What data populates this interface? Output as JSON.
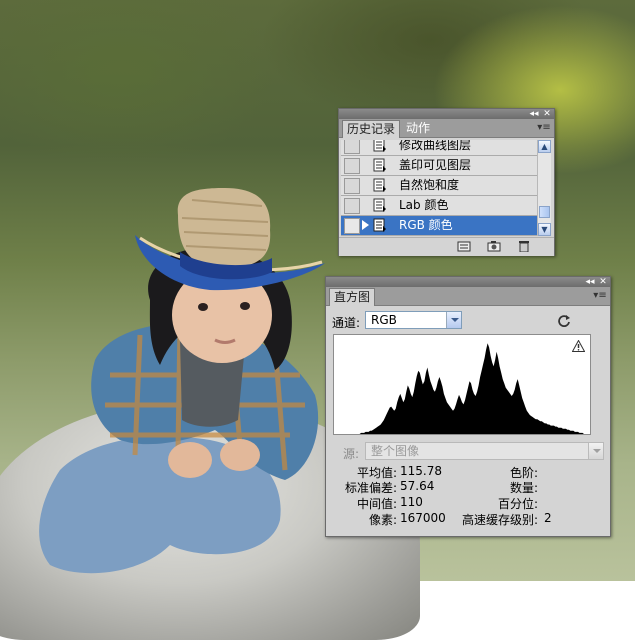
{
  "history_panel": {
    "tabs": [
      {
        "label": "历史记录",
        "active": true
      },
      {
        "label": "动作",
        "active": false
      }
    ],
    "items": [
      {
        "label": "修改曲线图层",
        "selected": false
      },
      {
        "label": "盖印可见图层",
        "selected": false
      },
      {
        "label": "自然饱和度",
        "selected": false
      },
      {
        "label": "Lab 颜色",
        "selected": false
      },
      {
        "label": "RGB 颜色",
        "selected": true
      }
    ],
    "footer_buttons": [
      "new-document-from-state-icon",
      "new-snapshot-icon",
      "delete-state-icon"
    ]
  },
  "histogram_panel": {
    "tab_label": "直方图",
    "channel_label": "通道:",
    "channel_value": "RGB",
    "source_label": "源:",
    "source_value": "整个图像",
    "stats_left": [
      {
        "label": "平均值:",
        "value": "115.78"
      },
      {
        "label": "标准偏差:",
        "value": "57.64"
      },
      {
        "label": "中间值:",
        "value": "110"
      },
      {
        "label": "像素:",
        "value": "167000"
      }
    ],
    "stats_right": [
      {
        "label": "色阶:",
        "value": ""
      },
      {
        "label": "数量:",
        "value": ""
      },
      {
        "label": "百分位:",
        "value": ""
      },
      {
        "label": "高速缓存级别:",
        "value": "2"
      }
    ],
    "histogram_levels": [
      0,
      0,
      0,
      0,
      0,
      0,
      0,
      0,
      0,
      0,
      0,
      0,
      0,
      0,
      0,
      0,
      0,
      0,
      1,
      1,
      1,
      2,
      2,
      2,
      3,
      3,
      4,
      5,
      6,
      7,
      8,
      9,
      11,
      13,
      16,
      19,
      22,
      25,
      26,
      24,
      22,
      24,
      30,
      35,
      38,
      34,
      30,
      33,
      40,
      46,
      43,
      38,
      35,
      40,
      48,
      55,
      60,
      58,
      52,
      47,
      50,
      58,
      63,
      56,
      50,
      46,
      42,
      40,
      44,
      50,
      54,
      50,
      45,
      38,
      34,
      30,
      28,
      26,
      24,
      22,
      24,
      28,
      33,
      37,
      34,
      30,
      28,
      32,
      38,
      44,
      50,
      48,
      42,
      38,
      36,
      40,
      46,
      54,
      60,
      66,
      72,
      80,
      86,
      82,
      74,
      68,
      64,
      70,
      78,
      72,
      64,
      58,
      52,
      48,
      44,
      42,
      40,
      38,
      36,
      38,
      42,
      48,
      52,
      46,
      40,
      34,
      30,
      26,
      22,
      20,
      18,
      17,
      16,
      15,
      14,
      14,
      13,
      12,
      12,
      11,
      10,
      10,
      9,
      9,
      8,
      8,
      8,
      7,
      7,
      6,
      6,
      6,
      5,
      5,
      5,
      4,
      4,
      3,
      3,
      3,
      2,
      2,
      2,
      1,
      1,
      1,
      0,
      0,
      0,
      0,
      0
    ]
  },
  "colors": {
    "panel_bg": "#d4d4d4",
    "selection": "#3a74c4",
    "titlebar": "#6c6c6c"
  }
}
